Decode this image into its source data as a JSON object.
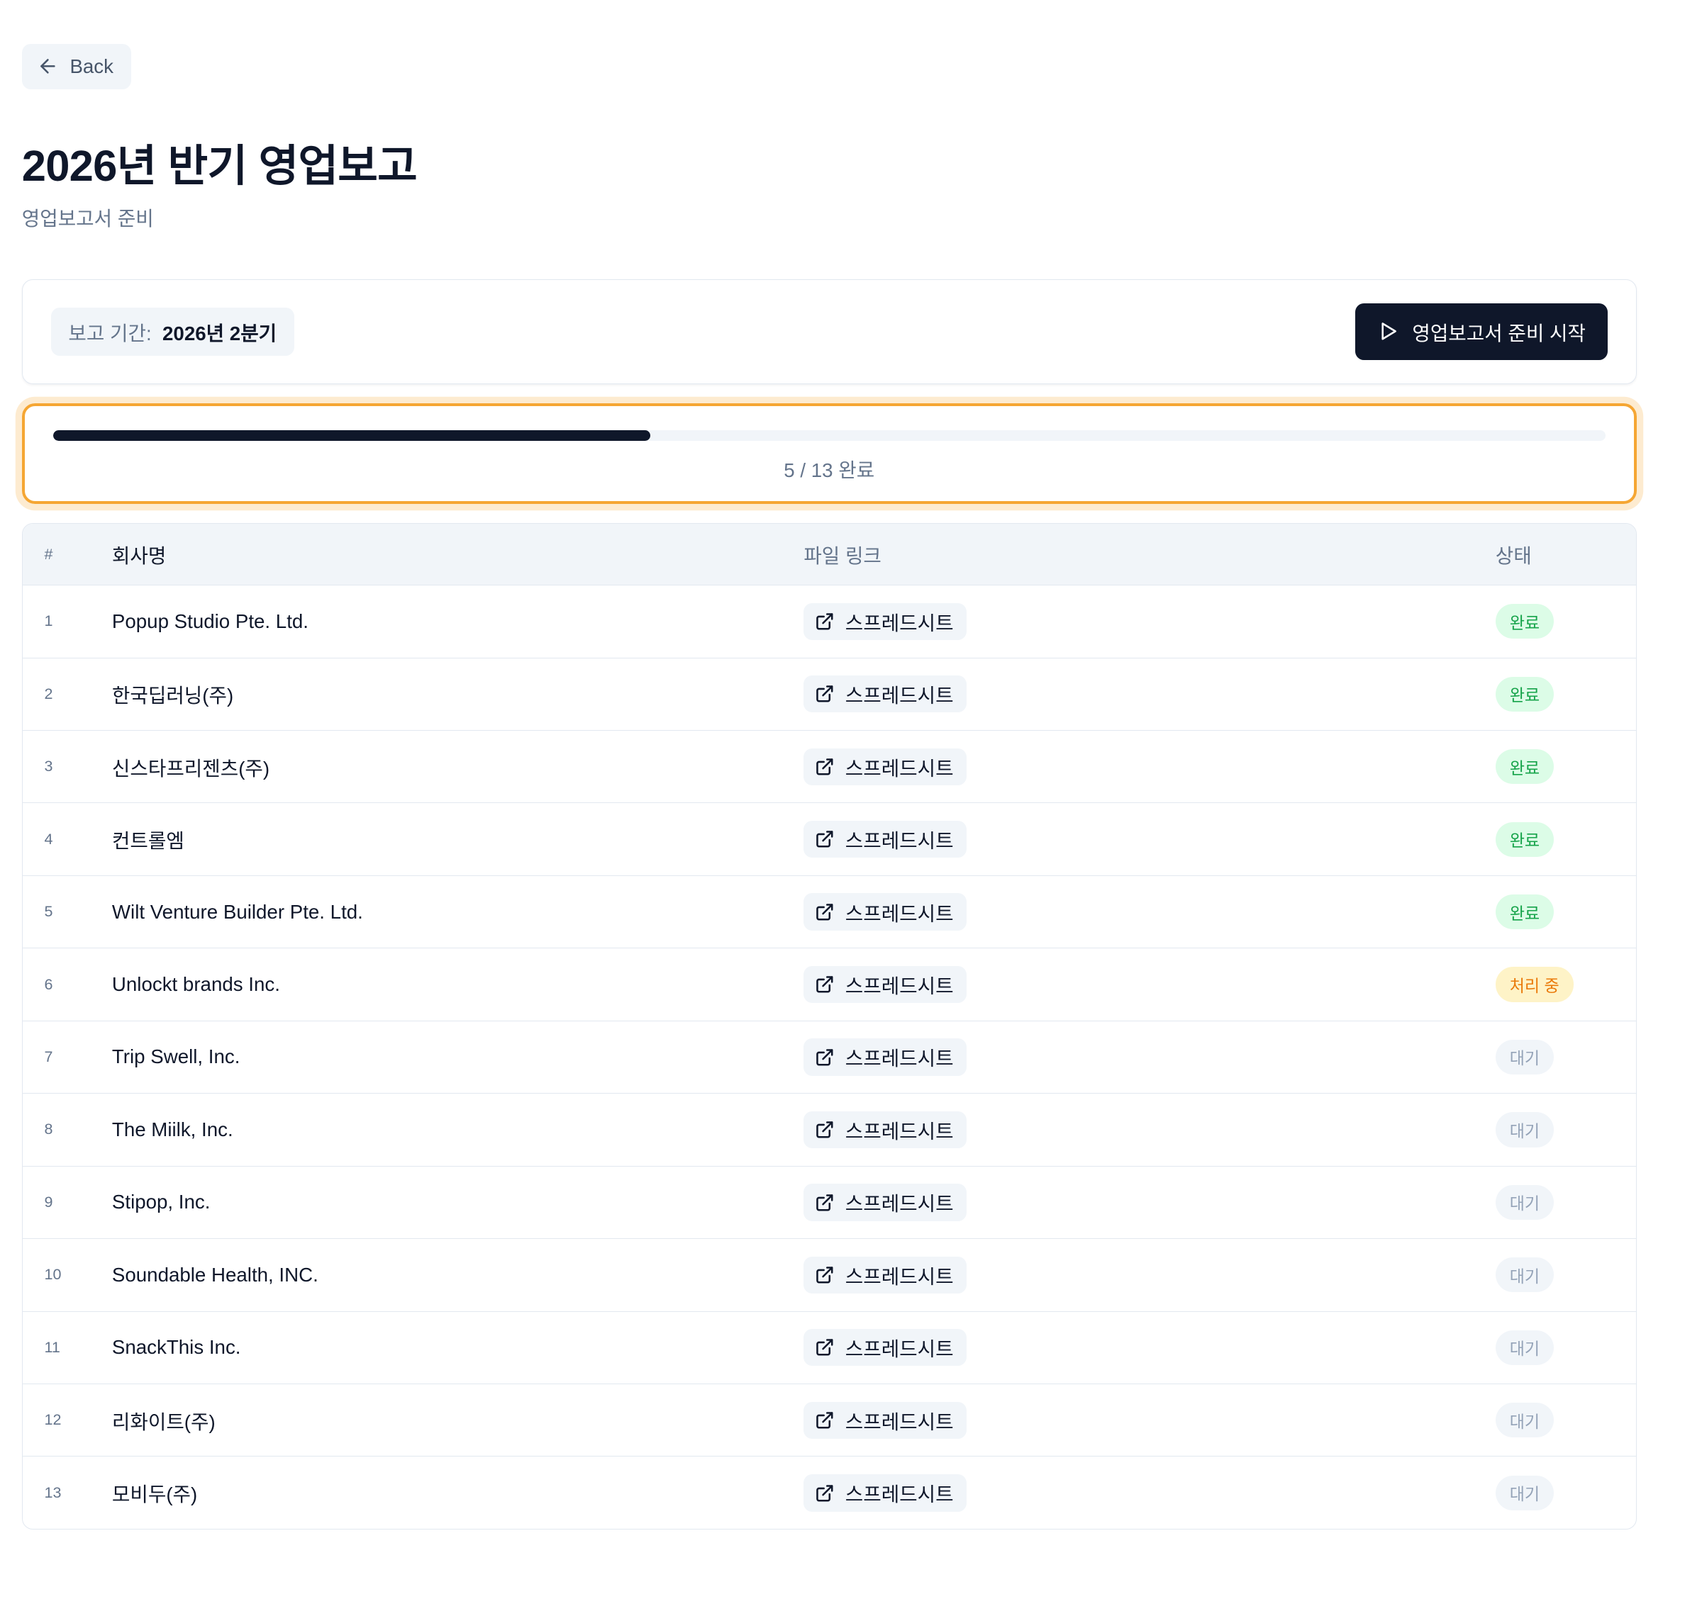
{
  "nav": {
    "back_label": "Back"
  },
  "header": {
    "title": "2026년 반기 영업보고",
    "subtitle": "영업보고서 준비"
  },
  "controls": {
    "period_label": "보고 기간:",
    "period_value": "2026년 2분기",
    "start_button_label": "영업보고서 준비 시작"
  },
  "progress": {
    "completed": 5,
    "total": 13,
    "text": "5 / 13 완료"
  },
  "table": {
    "columns": {
      "num": "#",
      "company": "회사명",
      "link": "파일 링크",
      "status": "상태"
    },
    "link_label": "스프레드시트",
    "rows": [
      {
        "num": "1",
        "company": "Popup Studio Pte. Ltd.",
        "status": "완료",
        "status_type": "done"
      },
      {
        "num": "2",
        "company": "한국딥러닝(주)",
        "status": "완료",
        "status_type": "done"
      },
      {
        "num": "3",
        "company": "신스타프리젠츠(주)",
        "status": "완료",
        "status_type": "done"
      },
      {
        "num": "4",
        "company": "컨트롤엠",
        "status": "완료",
        "status_type": "done"
      },
      {
        "num": "5",
        "company": "Wilt Venture Builder Pte. Ltd.",
        "status": "완료",
        "status_type": "done"
      },
      {
        "num": "6",
        "company": "Unlockt brands Inc.",
        "status": "처리 중",
        "status_type": "processing"
      },
      {
        "num": "7",
        "company": "Trip Swell, Inc.",
        "status": "대기",
        "status_type": "waiting"
      },
      {
        "num": "8",
        "company": "The Miilk, Inc.",
        "status": "대기",
        "status_type": "waiting"
      },
      {
        "num": "9",
        "company": "Stipop, Inc.",
        "status": "대기",
        "status_type": "waiting"
      },
      {
        "num": "10",
        "company": "Soundable Health, INC.",
        "status": "대기",
        "status_type": "waiting"
      },
      {
        "num": "11",
        "company": "SnackThis Inc.",
        "status": "대기",
        "status_type": "waiting"
      },
      {
        "num": "12",
        "company": "리화이트(주)",
        "status": "대기",
        "status_type": "waiting"
      },
      {
        "num": "13",
        "company": "모비두(주)",
        "status": "대기",
        "status_type": "waiting"
      }
    ]
  },
  "colors": {
    "primary": "#0f172a",
    "highlight_border": "#f5a633",
    "done": "#16a34a",
    "processing": "#ea7a0a",
    "waiting": "#94a3b8"
  },
  "icons": {
    "back": "arrow-left-icon",
    "start": "play-icon",
    "link": "external-link-icon"
  }
}
